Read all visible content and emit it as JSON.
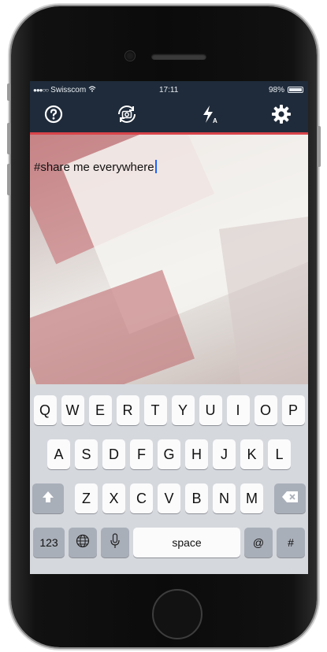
{
  "status_bar": {
    "carrier": "Swisscom",
    "signal_dots": "●●●○○",
    "time": "17:11",
    "battery_percent": "98%",
    "battery_level": 0.98
  },
  "toolbar": {
    "help_icon": "question-circle-icon",
    "camera_switch_icon": "camera-rotate-icon",
    "flash_icon": "flash-auto-icon",
    "settings_icon": "gear-icon",
    "accent_color": "#d8444a",
    "background_color": "#1f2b3a"
  },
  "editor": {
    "caption_text": "#share me everywhere"
  },
  "keyboard": {
    "row1": [
      "Q",
      "W",
      "E",
      "R",
      "T",
      "Y",
      "U",
      "I",
      "O",
      "P"
    ],
    "row2": [
      "A",
      "S",
      "D",
      "F",
      "G",
      "H",
      "J",
      "K",
      "L"
    ],
    "row3": [
      "Z",
      "X",
      "C",
      "V",
      "B",
      "N",
      "M"
    ],
    "numbers_label": "123",
    "space_label": "space",
    "at_label": "@",
    "hash_label": "#",
    "shift_icon": "shift-arrow-icon",
    "delete_icon": "backspace-icon",
    "globe_icon": "globe-icon",
    "mic_icon": "microphone-icon"
  }
}
